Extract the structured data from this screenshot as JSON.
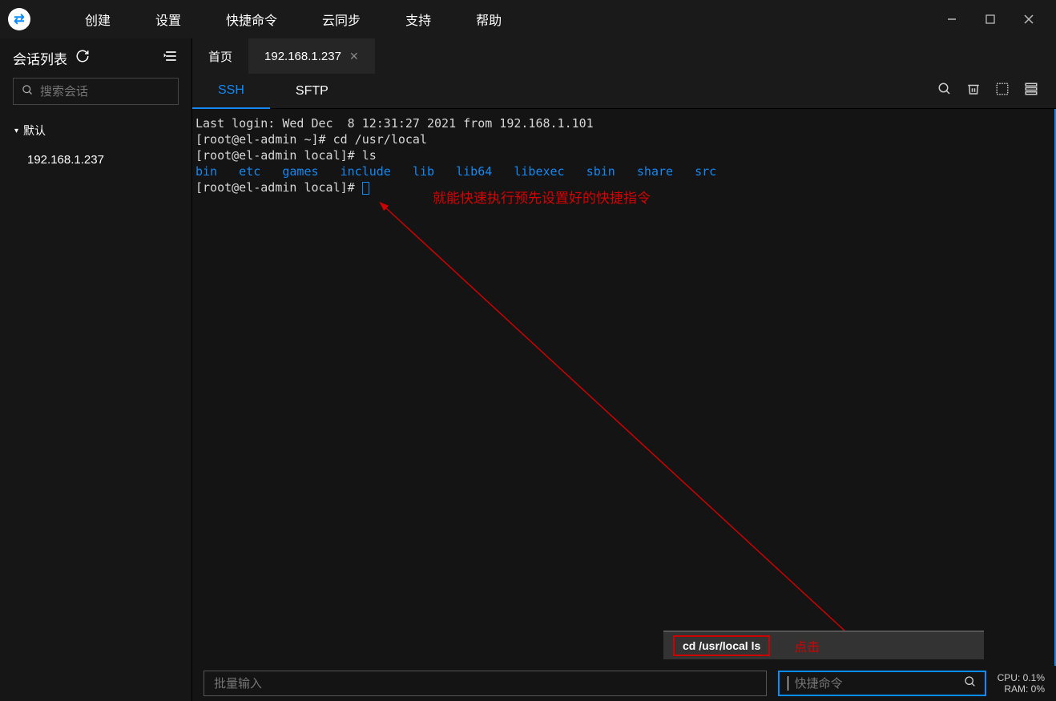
{
  "menu": {
    "create": "创建",
    "settings": "设置",
    "shortcut": "快捷命令",
    "cloudsync": "云同步",
    "support": "支持",
    "help": "帮助"
  },
  "sidebar": {
    "title": "会话列表",
    "search_placeholder": "搜索会话",
    "group_default": "默认",
    "items": [
      "192.168.1.237"
    ]
  },
  "tabs": {
    "home": "首页",
    "session": "192.168.1.237"
  },
  "subtabs": {
    "ssh": "SSH",
    "sftp": "SFTP"
  },
  "terminal": {
    "line1": "Last login: Wed Dec  8 12:31:27 2021 from 192.168.1.101",
    "line2a": "[root@el-admin ~]# ",
    "line2b": "cd /usr/local",
    "line3a": "[root@el-admin local]# ",
    "line3b": "ls",
    "dirs": "bin   etc   games   include   lib   lib64   libexec   sbin   share   src",
    "line5": "[root@el-admin local]# "
  },
  "annotation": {
    "text": "就能快速执行预先设置好的快捷指令",
    "shortcut_command": "cd /usr/local ls",
    "click_label": "点击"
  },
  "bottom": {
    "batch_placeholder": "批量输入",
    "quick_placeholder": "快捷命令"
  },
  "stats": {
    "cpu": "CPU: 0.1%",
    "ram": "RAM: 0%"
  }
}
